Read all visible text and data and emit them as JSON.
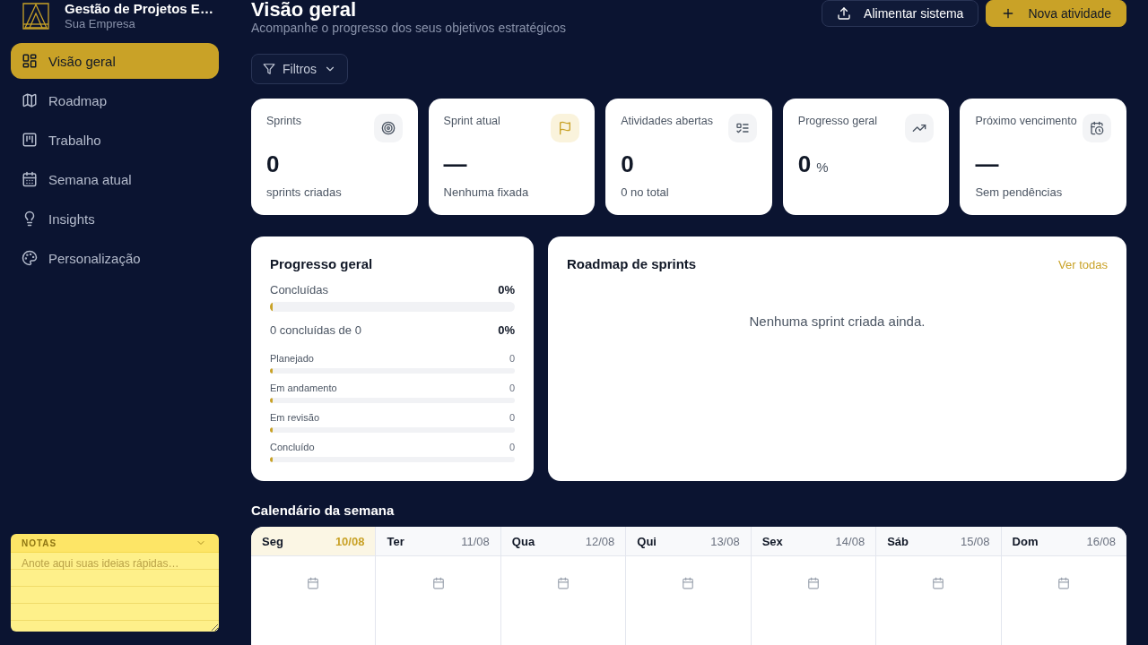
{
  "sidebar": {
    "brand": {
      "name": "Gestão de Projetos E…",
      "company": "Sua Empresa"
    },
    "items": [
      {
        "label": "Visão geral",
        "selected": true
      },
      {
        "label": "Roadmap",
        "selected": false
      },
      {
        "label": "Trabalho",
        "selected": false
      },
      {
        "label": "Semana atual",
        "selected": false
      },
      {
        "label": "Insights",
        "selected": false
      },
      {
        "label": "Personalização",
        "selected": false
      }
    ],
    "notes": {
      "title": "NOTAS",
      "placeholder": "Anote aqui suas ideias rápidas…"
    }
  },
  "header": {
    "title": "Visão geral",
    "subtitle": "Acompanhe o progresso dos seus objetivos estratégicos",
    "buttons": [
      {
        "label": "Alimentar sistema",
        "kind": "secondary"
      },
      {
        "label": "Nova atividade",
        "kind": "primary"
      }
    ]
  },
  "filters": {
    "label": "Filtros"
  },
  "stats": [
    {
      "label": "Sprints",
      "value": "0",
      "sub": "sprints criadas",
      "accent": false
    },
    {
      "label": "Sprint atual",
      "value": "—",
      "sub": "Nenhuma fixada",
      "accent": true
    },
    {
      "label": "Atividades abertas",
      "value": "0",
      "sub": "0 no total",
      "accent": false
    },
    {
      "label": "Progresso geral",
      "value": "0",
      "unit": "%",
      "accent": false
    },
    {
      "label": "Próximo vencimento",
      "value": "—",
      "sub": "Sem pendências",
      "accent": false
    }
  ],
  "progress": {
    "title": "Progresso geral",
    "summary": {
      "label": "Concluídas",
      "value": "0%",
      "level": 0
    },
    "detail": {
      "label": "0 concluídas de 0",
      "value": "0%"
    },
    "statuses": [
      {
        "label": "Planejado",
        "count": "0",
        "level": 0
      },
      {
        "label": "Em andamento",
        "count": "0",
        "level": 0
      },
      {
        "label": "Em revisão",
        "count": "0",
        "level": 0
      },
      {
        "label": "Concluído",
        "count": "0",
        "level": 0
      }
    ]
  },
  "roadmap": {
    "title": "Roadmap de sprints",
    "link": "Ver todas",
    "empty": "Nenhuma sprint criada ainda."
  },
  "calendar": {
    "title": "Calendário da semana",
    "days": [
      {
        "name": "Seg",
        "date": "10/08",
        "selected": true
      },
      {
        "name": "Ter",
        "date": "11/08",
        "selected": false
      },
      {
        "name": "Qua",
        "date": "12/08",
        "selected": false
      },
      {
        "name": "Qui",
        "date": "13/08",
        "selected": false
      },
      {
        "name": "Sex",
        "date": "14/08",
        "selected": false
      },
      {
        "name": "Sáb",
        "date": "15/08",
        "selected": false
      },
      {
        "name": "Dom",
        "date": "16/08",
        "selected": false
      }
    ]
  }
}
